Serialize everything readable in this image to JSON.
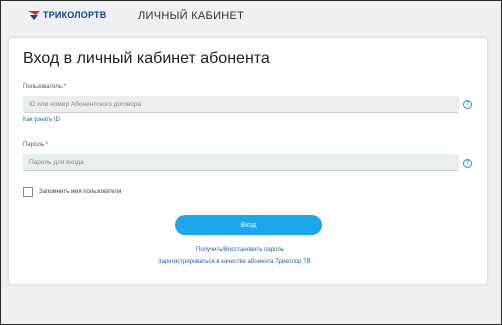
{
  "header": {
    "logo_text": "ТРИКОЛОРТВ",
    "title": "ЛИЧНЫЙ КАБИНЕТ"
  },
  "login": {
    "title": "Вход в личный кабинет абонента",
    "user_label": "Пользователь:*",
    "user_placeholder": "ID или номер Абонентского договора",
    "user_value": "",
    "find_id_link": "Как узнать ID",
    "password_label": "Пароль:*",
    "password_placeholder": "Пароль для входа",
    "password_value": "",
    "help_glyph": "?",
    "remember_label": "Запомнить имя пользователя",
    "remember_checked": false,
    "submit_label": "Вход",
    "recover_link": "Получить/Восстановить пароль",
    "register_link": "Зарегистрироваться в качестве абонента Триколор ТВ"
  },
  "colors": {
    "brand_blue": "#1a3d8f",
    "accent_red": "#d8232a",
    "button_blue": "#1ea6ec",
    "link_blue": "#2a5fa8",
    "input_bg": "#e9eef0",
    "page_bg": "#eef0f3"
  },
  "icons": {
    "logo": "tricolor-logo-icon",
    "help": "question-circle-icon"
  }
}
